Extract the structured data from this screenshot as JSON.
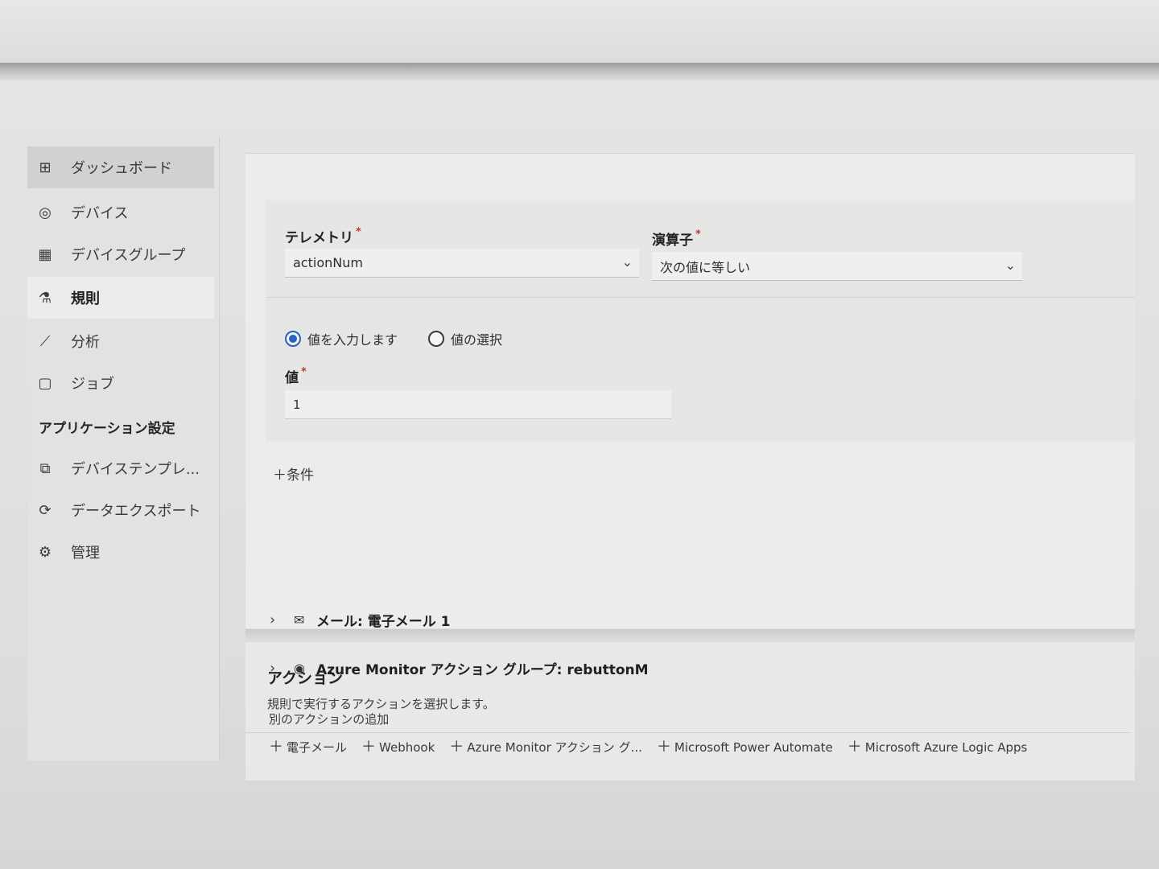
{
  "sidebar": {
    "items": [
      {
        "label": "ダッシュボード",
        "icon": "dashboard-icon",
        "glyph": "⊞"
      },
      {
        "label": "デバイス",
        "icon": "device-icon",
        "glyph": "◎"
      },
      {
        "label": "デバイスグループ",
        "icon": "device-group-icon",
        "glyph": "▦"
      },
      {
        "label": "規則",
        "icon": "rules-icon",
        "glyph": "⚗"
      },
      {
        "label": "分析",
        "icon": "analytics-icon",
        "glyph": "⟋"
      },
      {
        "label": "ジョブ",
        "icon": "jobs-icon",
        "glyph": "▢"
      }
    ],
    "section_title": "アプリケーション設定",
    "settings_items": [
      {
        "label": "デバイステンプレ...",
        "icon": "device-template-icon",
        "glyph": "⧉"
      },
      {
        "label": "データエクスポート",
        "icon": "data-export-icon",
        "glyph": "⟳"
      },
      {
        "label": "管理",
        "icon": "admin-icon",
        "glyph": "⚙"
      }
    ],
    "selected_index": 3
  },
  "condition": {
    "telemetry_label": "テレメトリ",
    "telemetry_value": "actionNum",
    "operator_label": "演算子",
    "operator_value": "次の値に等しい",
    "required_mark": "*",
    "radio_enter": "値を入力します",
    "radio_select": "値の選択",
    "radio_selected": "enter",
    "value_label": "値",
    "value_input": "1",
    "add_condition": "条件"
  },
  "actions": {
    "title": "アクション",
    "subtitle": "規則で実行するアクションを選択します。",
    "items": [
      {
        "label": "メール: 電子メール 1",
        "icon": "mail-icon",
        "glyph": "✉"
      },
      {
        "label": "Azure Monitor アクション グループ: rebuttonM",
        "icon": "azure-monitor-icon",
        "glyph": "◉"
      }
    ],
    "add_other_label": "別のアクションの追加",
    "add_links": [
      "電子メール",
      "Webhook",
      "Azure Monitor アクション グ...",
      "Microsoft Power Automate",
      "Microsoft Azure Logic Apps"
    ]
  },
  "colors": {
    "accent": "#2563c9",
    "required": "#c0392b"
  }
}
